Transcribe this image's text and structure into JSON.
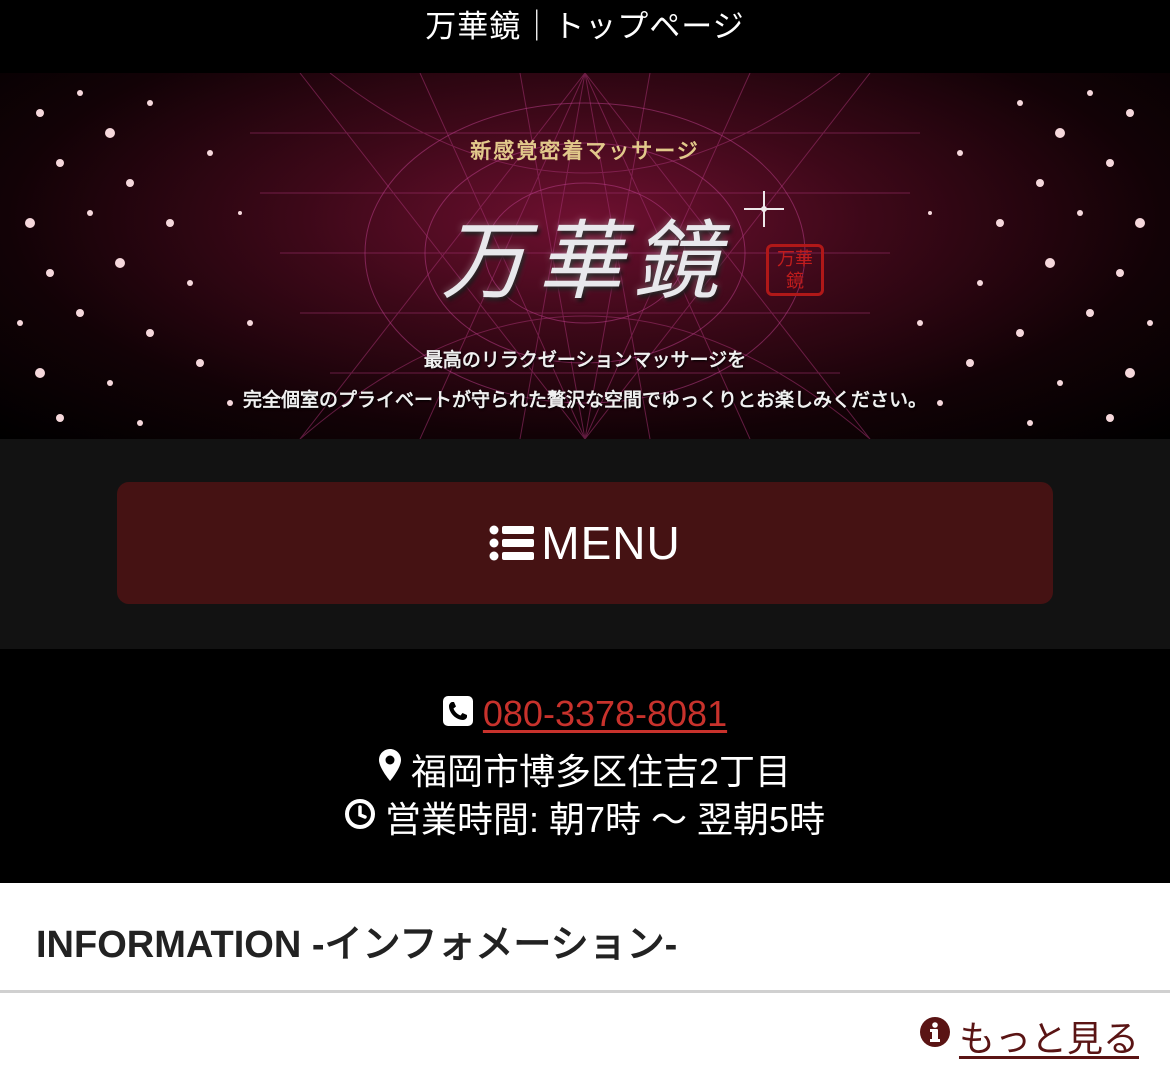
{
  "page": {
    "title": "万華鏡｜トップページ"
  },
  "hero": {
    "tagline": "新感覚密着マッサージ",
    "logo_text": "万華鏡",
    "seal_text": "万華鏡",
    "description_line1": "最高のリラクゼーションマッサージを",
    "description_line2": "完全個室のプライベートが守られた贅沢な空間でゆっくりとお楽しみください。"
  },
  "menu": {
    "label": "MENU",
    "icon": "list-icon"
  },
  "contact": {
    "phone": "080-3378-8081",
    "phone_icon": "phone-icon",
    "address": "福岡市博多区住吉2丁目",
    "address_icon": "map-marker-icon",
    "hours": "営業時間: 朝7時 〜 翌朝5時",
    "hours_icon": "clock-icon"
  },
  "information": {
    "title": "INFORMATION -インフォメーション-",
    "more_label": "もっと見る",
    "more_icon": "info-circle-icon"
  },
  "colors": {
    "menu_button_bg": "#451213",
    "phone_link": "#c8322c",
    "more_link": "#5a1414",
    "menu_area_bg": "#121212"
  }
}
